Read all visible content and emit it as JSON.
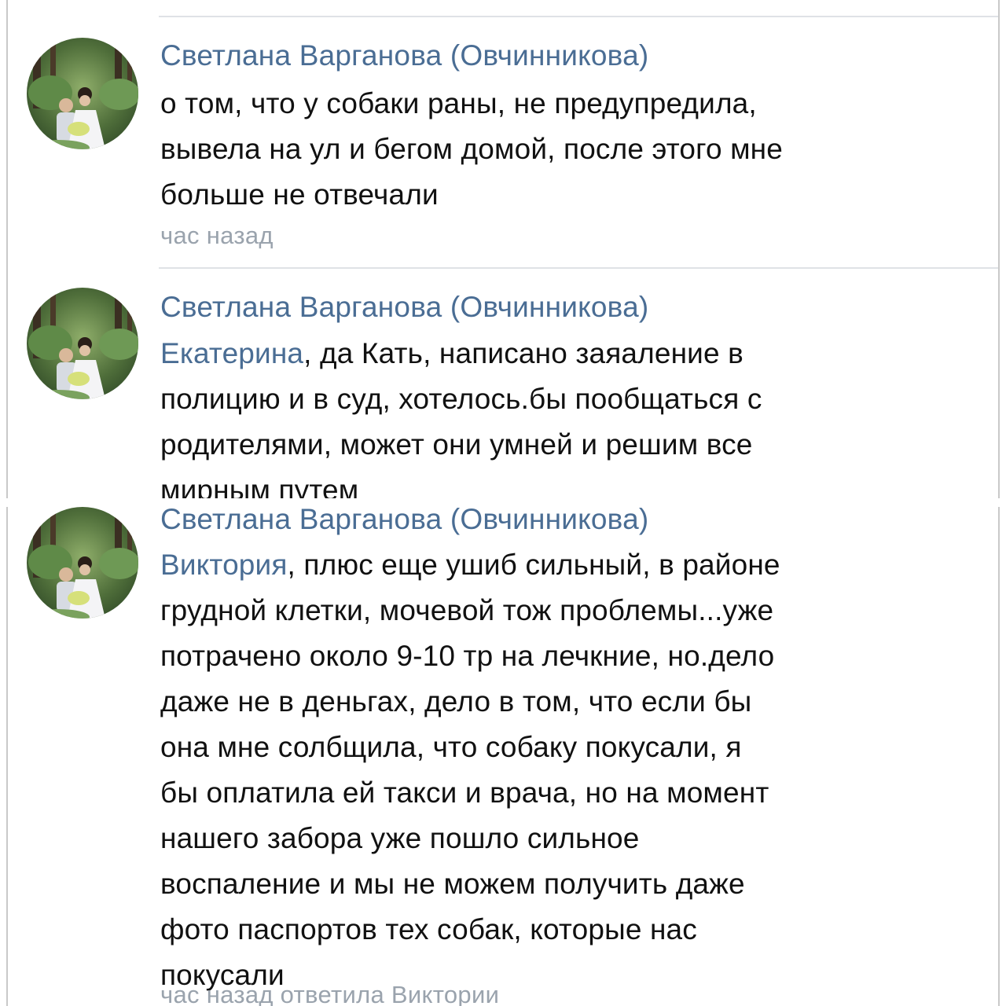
{
  "colors": {
    "author_link": "#4a6d94",
    "text": "#111111",
    "meta": "#9aa3ad",
    "separator": "#dfe2e6"
  },
  "comments": [
    {
      "author": "Светлана Варганова (Овчинникова)",
      "avatar": "user-photo-avatar",
      "lines": [
        "о том, что у собаки раны, не предупредила,",
        "вывела на ул и бегом домой, после этого мне",
        "больше не отвечали"
      ],
      "meta": "час назад"
    },
    {
      "author": "Светлана Варганова (Овчинникова)",
      "avatar": "user-photo-avatar",
      "mention": "Екатерина",
      "lines": [
        ", да Кать, написано заяаление в",
        "полицию и в суд, хотелось.бы пообщаться с",
        "родителями, может они умней и решим все",
        "мирным путем"
      ]
    },
    {
      "author": "Светлана Варганова (Овчинникова)",
      "avatar": "user-photo-avatar",
      "mention": "Виктория",
      "lines": [
        ", плюс еще ушиб сильный, в районе",
        "грудной клетки, мочевой тож проблемы...уже",
        "потрачено около 9-10 тр на лечкние, но.дело",
        "даже не в деньгах, дело в том, что если бы",
        "она мне солбщила, что собаку покусали, я",
        "бы оплатила ей такси и врача, но на момент",
        "нашего забора уже пошло сильное",
        "воспаление и мы не можем получить даже",
        "фото паспортов тех собак, которые нас",
        "покусали"
      ],
      "meta": "час назад ответила Виктории"
    }
  ]
}
